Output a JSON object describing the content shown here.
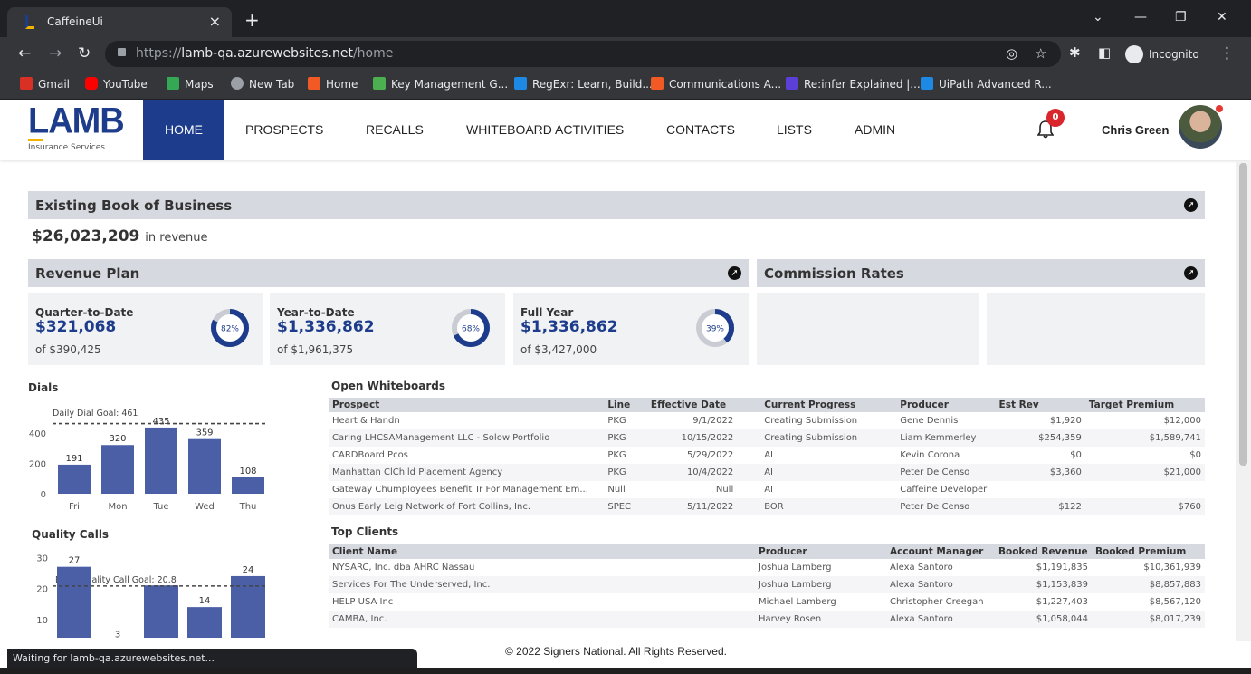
{
  "browser": {
    "tab_title": "CaffeineUi",
    "url_prefix": "https://",
    "url_host": "lamb-qa.azurewebsites.net",
    "url_path": "/home",
    "incognito_label": "Incognito",
    "bookmarks": [
      {
        "label": "Gmail",
        "color": "#d93025"
      },
      {
        "label": "YouTube",
        "color": "#ff0000"
      },
      {
        "label": "Maps",
        "color": "#34a853"
      },
      {
        "label": "New Tab",
        "color": "#9aa0a6"
      },
      {
        "label": "Home",
        "color": "#f15a24"
      },
      {
        "label": "Key Management G...",
        "color": "#4caf50"
      },
      {
        "label": "RegExr: Learn, Build...",
        "color": "#1e88e5"
      },
      {
        "label": "Communications A...",
        "color": "#f15a24"
      },
      {
        "label": "Re:infer Explained |...",
        "color": "#5b3fd6"
      },
      {
        "label": "UiPath Advanced R...",
        "color": "#1e88e5"
      }
    ],
    "status_text": "Waiting for lamb-qa.azurewebsites.net..."
  },
  "app": {
    "logo": "LAMB",
    "logo_sub": "Insurance Services",
    "nav": [
      "HOME",
      "PROSPECTS",
      "RECALLS",
      "WHITEBOARD ACTIVITIES",
      "CONTACTS",
      "LISTS",
      "ADMIN"
    ],
    "active_nav": "HOME",
    "notification_count": "0",
    "user_name": "Chris Green",
    "brand_color": "#1d3c8b",
    "accent_color": "#f1b300"
  },
  "book": {
    "title": "Existing Book of Business",
    "revenue": "$26,023,209",
    "revenue_suffix": "in revenue"
  },
  "revenue_plan": {
    "title": "Revenue Plan",
    "cards": [
      {
        "label": "Quarter-to-Date",
        "value": "$321,068",
        "of": "of $390,425",
        "pct": 82,
        "pct_label": "82%"
      },
      {
        "label": "Year-to-Date",
        "value": "$1,336,862",
        "of": "of $1,961,375",
        "pct": 68,
        "pct_label": "68%"
      },
      {
        "label": "Full Year",
        "value": "$1,336,862",
        "of": "of $3,427,000",
        "pct": 39,
        "pct_label": "39%"
      }
    ]
  },
  "commission": {
    "title": "Commission Rates"
  },
  "dials": {
    "title": "Dials",
    "goal_label": "Daily Dial Goal: 461",
    "chart_data": {
      "type": "bar",
      "categories": [
        "Fri",
        "Mon",
        "Tue",
        "Wed",
        "Thu"
      ],
      "values": [
        191,
        320,
        435,
        359,
        108
      ],
      "goal": 461,
      "yticks": [
        "400",
        "200",
        "0"
      ],
      "ylim": [
        0,
        500
      ]
    }
  },
  "quality": {
    "title": "Quality Calls",
    "goal_label": "Daily Quality Call Goal: 20.8",
    "chart_data": {
      "type": "bar",
      "values": [
        27,
        3,
        21,
        14,
        24
      ],
      "value_labels": [
        "27",
        "3",
        "",
        "14",
        "24"
      ],
      "goal": 20.8,
      "yticks": [
        "30",
        "20",
        "10"
      ],
      "ylim": [
        0,
        31
      ]
    }
  },
  "whiteboards": {
    "title": "Open Whiteboards",
    "headers": [
      "Prospect",
      "Line",
      "Effective Date",
      "Current Progress",
      "Producer",
      "Est Rev",
      "Target Premium"
    ],
    "rows": [
      [
        "Heart & Handn",
        "PKG",
        "9/1/2022",
        "Creating Submission",
        "Gene Dennis",
        "$1,920",
        "$12,000"
      ],
      [
        "Caring LHCSAManagement LLC - Solow Portfolio",
        "PKG",
        "10/15/2022",
        "Creating Submission",
        "Liam Kemmerley",
        "$254,359",
        "$1,589,741"
      ],
      [
        "CARDBoard Pcos",
        "PKG",
        "5/29/2022",
        "AI",
        "Kevin Corona",
        "$0",
        "$0"
      ],
      [
        "Manhattan ClChild Placement Agency",
        "PKG",
        "10/4/2022",
        "AI",
        "Peter De Censo",
        "$3,360",
        "$21,000"
      ],
      [
        "Gateway Chumployees Benefit Tr For Management Em...",
        "Null",
        "Null",
        "AI",
        "Caffeine Developer",
        "",
        ""
      ],
      [
        "Onus Early Leig Network of Fort Collins, Inc.",
        "SPEC",
        "5/11/2022",
        "BOR",
        "Peter De Censo",
        "$122",
        "$760"
      ]
    ]
  },
  "clients": {
    "title": "Top Clients",
    "headers": [
      "Client Name",
      "Producer",
      "Account Manager",
      "Booked Revenue",
      "Booked Premium"
    ],
    "rows": [
      [
        "NYSARC, Inc. dba AHRC Nassau",
        "Joshua Lamberg",
        "Alexa Santoro",
        "$1,191,835",
        "$10,361,939"
      ],
      [
        "Services For The Underserved, Inc.",
        "Joshua Lamberg",
        "Alexa Santoro",
        "$1,153,839",
        "$8,857,883"
      ],
      [
        "HELP USA Inc",
        "Michael Lamberg",
        "Christopher Creegan",
        "$1,227,403",
        "$8,567,120"
      ],
      [
        "CAMBA, Inc.",
        "Harvey Rosen",
        "Alexa Santoro",
        "$1,058,044",
        "$8,017,239"
      ]
    ]
  },
  "footer": "© 2022 Signers National. All Rights Reserved."
}
